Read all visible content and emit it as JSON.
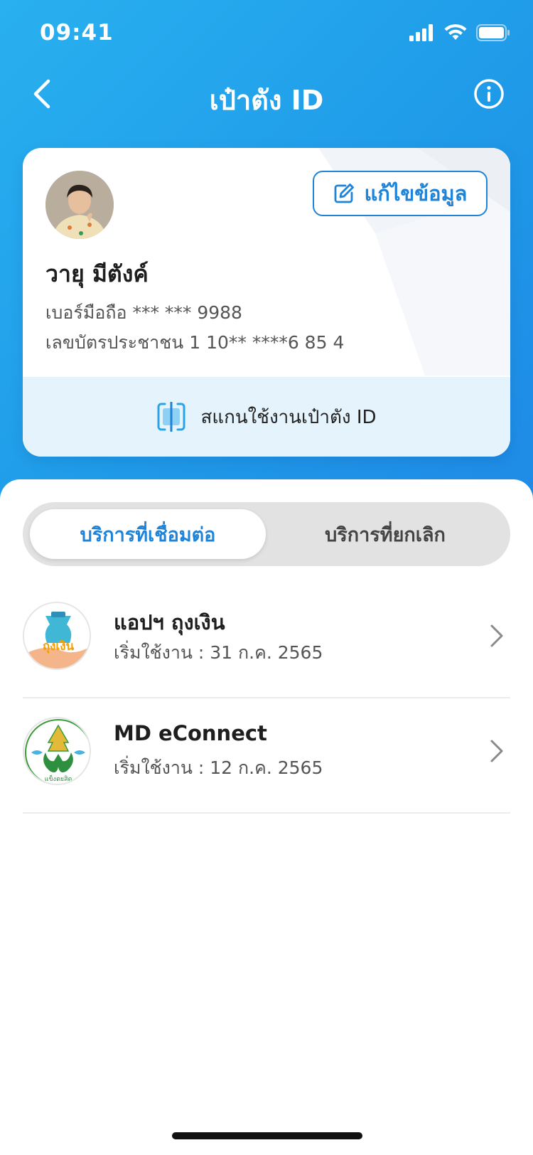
{
  "status_bar": {
    "time": "09:41"
  },
  "header": {
    "title": "เป๋าตัง ID"
  },
  "profile": {
    "edit_label": "แก้ไขข้อมูล",
    "name": "วายุ มีตังค์",
    "phone": "เบอร์มือถือ *** *** 9988",
    "id_card": "เลขบัตรประชาชน 1 10** ****6 85 4",
    "scan_label": "สแกนใช้งานเป๋าตัง ID"
  },
  "tabs": [
    {
      "label": "บริการที่เชื่อมต่อ",
      "active": true
    },
    {
      "label": "บริการที่ยกเลิก",
      "active": false
    }
  ],
  "services": [
    {
      "name": "แอปฯ ถุงเงิน",
      "start": "เริ่มใช้งาน : 31 ก.ค. 2565",
      "logo_text": "ถุงเงิน"
    },
    {
      "name": "MD eConnect",
      "start": "เริ่มใช้งาน : 12 ก.ค. 2565",
      "logo_text": "แข็งตยสิต"
    }
  ],
  "colors": {
    "primary": "#1f83d8",
    "hero": "#1f9be8",
    "scan_bg": "#e4f3fc"
  }
}
